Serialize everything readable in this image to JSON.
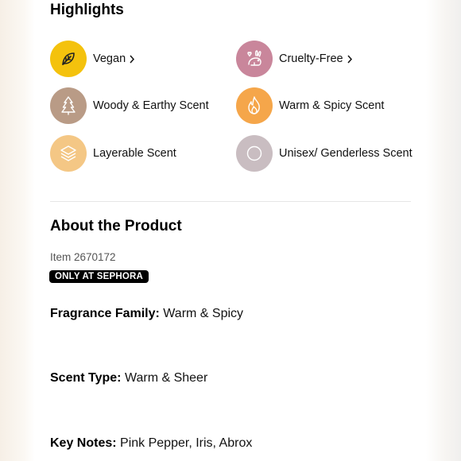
{
  "highlights": {
    "title": "Highlights",
    "items": [
      {
        "label": "Vegan",
        "icon": "leaf-icon",
        "color": "#f4c20d",
        "has_link": true
      },
      {
        "label": "Cruelty-Free",
        "icon": "bunny-heart-icon",
        "color": "#c9869b",
        "has_link": true
      },
      {
        "label": "Woody & Earthy Scent",
        "icon": "tree-icon",
        "color": "#b99b86",
        "has_link": false
      },
      {
        "label": "Warm & Spicy Scent",
        "icon": "flame-icon",
        "color": "#f5a64a",
        "has_link": false
      },
      {
        "label": "Layerable Scent",
        "icon": "layers-icon",
        "color": "#f4c785",
        "has_link": false
      },
      {
        "label": "Unisex/ Genderless Scent",
        "icon": "circle-icon",
        "color": "#c9bdc1",
        "has_link": false
      }
    ]
  },
  "about": {
    "title": "About the Product",
    "item_number": "Item 2670172",
    "badge": "ONLY AT SEPHORA",
    "details": [
      {
        "label": "Fragrance Family:",
        "value": "Warm & Spicy"
      },
      {
        "label": "Scent Type:",
        "value": "Warm & Sheer"
      },
      {
        "label": "Key Notes:",
        "value": "Pink Pepper, Iris, Abrox"
      }
    ]
  }
}
